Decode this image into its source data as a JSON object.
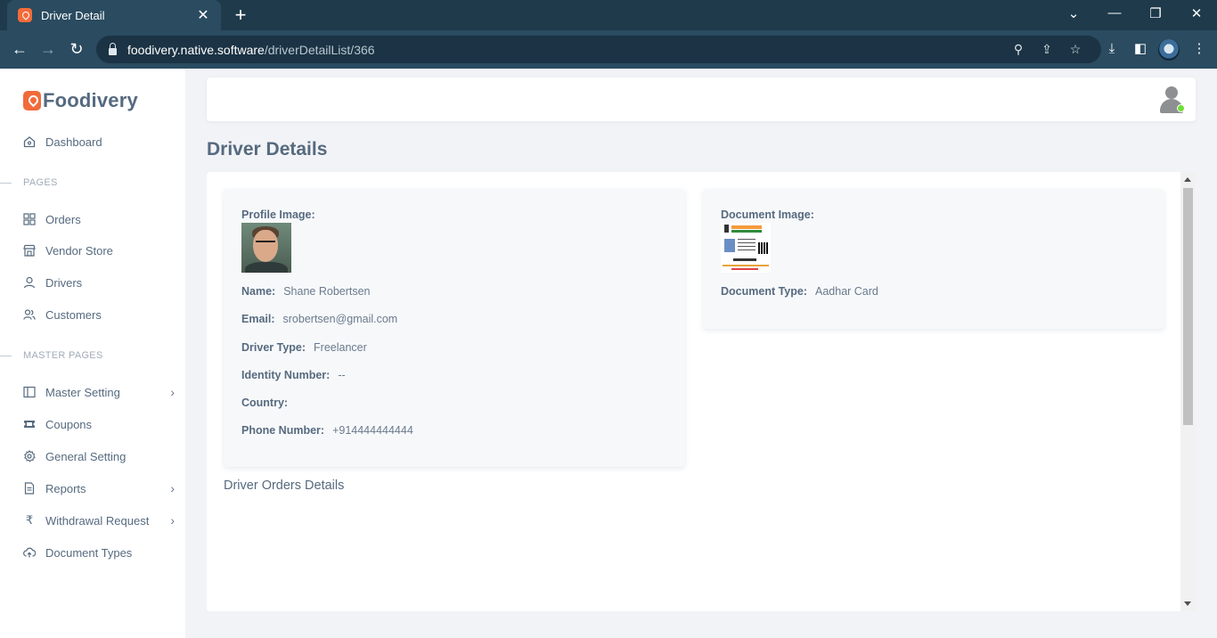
{
  "browser": {
    "tab_title": "Driver Detail",
    "url_host": "foodivery.native.software",
    "url_path": "/driverDetailList/366"
  },
  "sidebar": {
    "brand": "Foodivery",
    "dashboard": "Dashboard",
    "section_pages": "PAGES",
    "orders": "Orders",
    "vendor_store": "Vendor Store",
    "drivers": "Drivers",
    "customers": "Customers",
    "section_master": "MASTER PAGES",
    "master_setting": "Master Setting",
    "coupons": "Coupons",
    "general_setting": "General Setting",
    "reports": "Reports",
    "withdrawal_request": "Withdrawal Request",
    "document_types": "Document Types"
  },
  "page": {
    "title": "Driver Details",
    "orders_title": "Driver Orders Details"
  },
  "profile": {
    "image_label": "Profile Image:",
    "name_label": "Name:",
    "name": "Shane Robertsen",
    "email_label": "Email:",
    "email": "srobertsen@gmail.com",
    "driver_type_label": "Driver Type:",
    "driver_type": "Freelancer",
    "identity_label": "Identity Number:",
    "identity": "--",
    "country_label": "Country:",
    "country": "",
    "phone_label": "Phone Number:",
    "phone": "+914444444444"
  },
  "document": {
    "image_label": "Document Image:",
    "type_label": "Document Type:",
    "type": "Aadhar Card"
  }
}
